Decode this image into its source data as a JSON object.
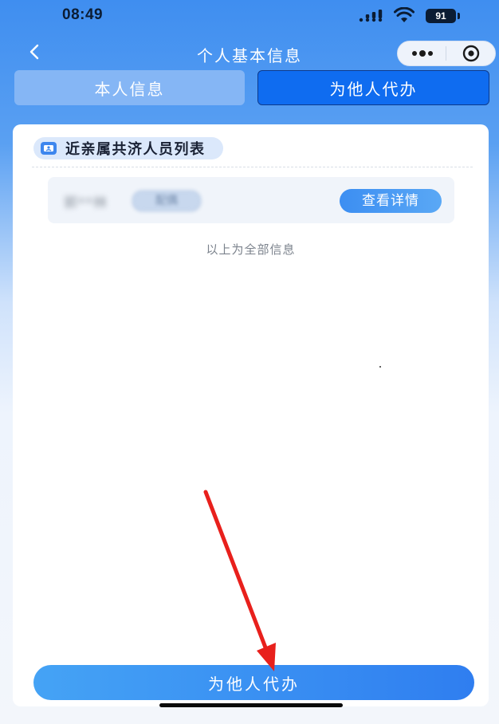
{
  "status_bar": {
    "time": "08:49",
    "battery": "91"
  },
  "nav": {
    "title": "个人基本信息",
    "back_icon": "chevron-left-icon",
    "more_icon": "more-dots-icon",
    "close_icon": "target-icon"
  },
  "tabs": [
    {
      "label": "本人信息",
      "selected": false
    },
    {
      "label": "为他人代办",
      "selected": true
    }
  ],
  "section": {
    "title": "近亲属共济人员列表",
    "icon": "id-card-icon"
  },
  "members": [
    {
      "name": "郭**林",
      "relation": "配偶",
      "action_label": "查看详情"
    }
  ],
  "footer_note": "以上为全部信息",
  "bottom_button": {
    "label": "为他人代办"
  },
  "colors": {
    "primary": "#0f6cf0",
    "accent": "#3c8ef2",
    "annotation_arrow": "#e8201c"
  }
}
